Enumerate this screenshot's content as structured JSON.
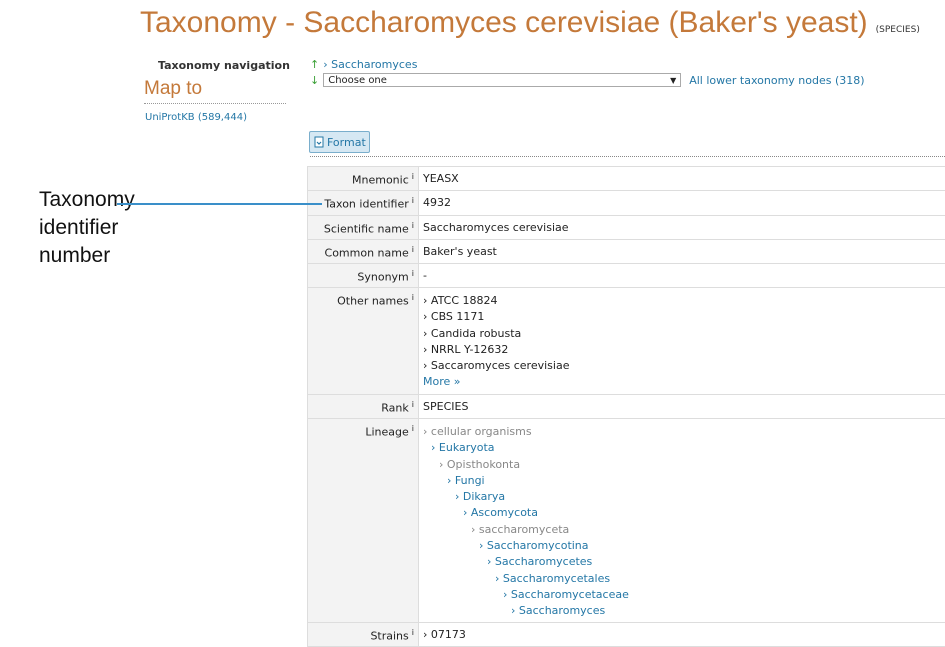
{
  "page": {
    "title": "Taxonomy - Saccharomyces cerevisiae (Baker's yeast)",
    "rank_badge": "(SPECIES)"
  },
  "sidebar": {
    "nav_heading": "Taxonomy navigation",
    "map_to": "Map to",
    "uniprot_link": "UniProtKB (589,444)"
  },
  "navigation": {
    "up_link": "› Saccharomyces",
    "select_value": "Choose one",
    "all_lower_link": "All lower taxonomy nodes (318)"
  },
  "toolbar": {
    "format_label": "Format"
  },
  "rows": {
    "mnemonic": {
      "label": "Mnemonic",
      "value": "YEASX"
    },
    "taxon_identifier": {
      "label": "Taxon identifier",
      "value": "4932"
    },
    "scientific_name": {
      "label": "Scientific name",
      "value": "Saccharomyces cerevisiae"
    },
    "common_name": {
      "label": "Common name",
      "value": "Baker's yeast"
    },
    "synonym": {
      "label": "Synonym",
      "value": "-"
    },
    "other_names": {
      "label": "Other names",
      "items": [
        "› ATCC 18824",
        "› CBS 1171",
        "› Candida robusta",
        "› NRRL Y-12632",
        "› Saccaromyces cerevisiae"
      ],
      "more": "More »"
    },
    "rank": {
      "label": "Rank",
      "value": "SPECIES"
    },
    "lineage": {
      "label": "Lineage",
      "items": [
        "› cellular organisms",
        "› Eukaryota",
        "› Opisthokonta",
        "› Fungi",
        "› Dikarya",
        "› Ascomycota",
        "› saccharomyceta",
        "› Saccharomycotina",
        "› Saccharomycetes",
        "› Saccharomycetales",
        "› Saccharomycetaceae",
        "› Saccharomyces"
      ]
    },
    "strains": {
      "label": "Strains",
      "value": "› 07173"
    },
    "info_marker": "i"
  },
  "annotation": {
    "line1": "Taxonomy",
    "line2": "identifier",
    "line3": "number",
    "color": "#3a8fc9"
  },
  "colors": {
    "title": "#c4793a",
    "link": "#2477a6",
    "gray_lineage": "#888888",
    "arrow": "#3aa035"
  }
}
